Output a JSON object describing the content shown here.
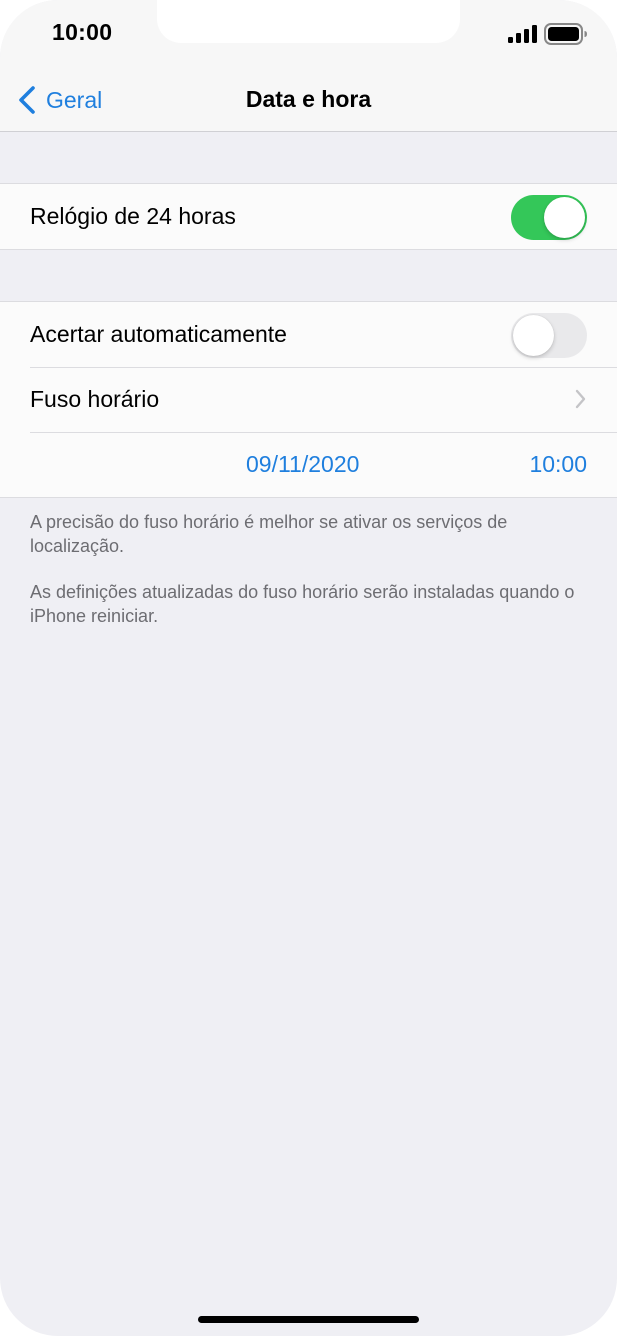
{
  "status_bar": {
    "time": "10:00"
  },
  "nav": {
    "back_label": "Geral",
    "title": "Data e hora"
  },
  "group_clock": {
    "rows": [
      {
        "label": "Relógio de 24 horas",
        "toggle": "on"
      }
    ]
  },
  "group_datetime": {
    "auto_label": "Acertar automaticamente",
    "auto_toggle": "off",
    "timezone_label": "Fuso horário",
    "date_value": "09/11/2020",
    "time_value": "10:00"
  },
  "footnotes": [
    "A precisão do fuso horário é melhor se ativar os serviços de localização.",
    "As definições atualizadas do fuso horário serão instaladas quando o iPhone reiniciar."
  ],
  "colors": {
    "accent": "#1f7fde",
    "toggle_on": "#34c759",
    "toggle_off": "#e9e9eb",
    "background": "#efeff4"
  },
  "icons": [
    "signal-icon",
    "battery-icon",
    "back-chevron-icon",
    "chevron-right-icon"
  ]
}
